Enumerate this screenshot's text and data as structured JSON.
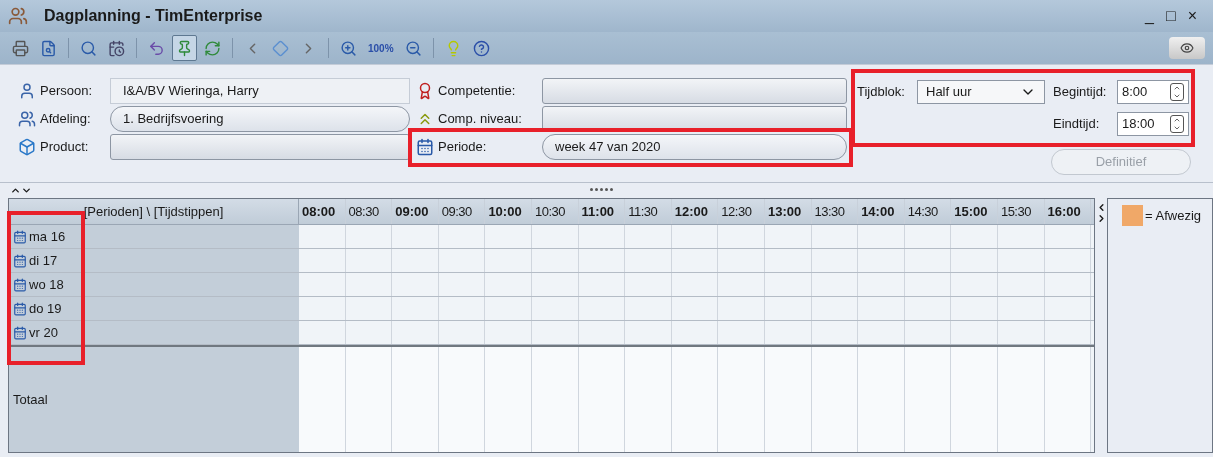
{
  "window": {
    "title": "Dagplanning - TimEnterprise",
    "controls": [
      "_",
      "□",
      "×"
    ]
  },
  "toolbar": [
    {
      "kind": "print",
      "pressed": false
    },
    {
      "kind": "preview",
      "pressed": false
    },
    {
      "kind": "sep"
    },
    {
      "kind": "search",
      "pressed": false
    },
    {
      "kind": "clock",
      "pressed": false
    },
    {
      "kind": "sep"
    },
    {
      "kind": "undo",
      "pressed": false
    },
    {
      "kind": "pin",
      "pressed": true
    },
    {
      "kind": "refresh",
      "pressed": false
    },
    {
      "kind": "sep"
    },
    {
      "kind": "prev",
      "pressed": false
    },
    {
      "kind": "diamond",
      "pressed": false
    },
    {
      "kind": "next",
      "pressed": false
    },
    {
      "kind": "sep"
    },
    {
      "kind": "zoomin",
      "pressed": false
    },
    {
      "kind": "zoom100",
      "label": "100%",
      "pressed": false
    },
    {
      "kind": "zoomout",
      "pressed": false
    },
    {
      "kind": "sep"
    },
    {
      "kind": "bulb",
      "pressed": false
    },
    {
      "kind": "help",
      "pressed": false
    }
  ],
  "form": {
    "left": [
      {
        "label": "Persoon:",
        "kind": "flat",
        "value": "I&A/BV Wieringa, Harry"
      },
      {
        "label": "Afdeling:",
        "kind": "pill",
        "value": "1. Bedrijfsvoering"
      },
      {
        "label": "Product:",
        "kind": "lookup"
      }
    ],
    "middle": [
      {
        "label": "Competentie:",
        "kind": "lookup",
        "highlighted": false
      },
      {
        "label": "Comp. niveau:",
        "kind": "lookup",
        "highlighted": false
      },
      {
        "label": "Periode:",
        "kind": "pill",
        "value": "week 47 van 2020",
        "highlighted": true
      }
    ],
    "time": {
      "highlighted": true,
      "block_label": "Tijdblok:",
      "block_value": "Half uur",
      "start_label": "Begintijd:",
      "start_value": "8:00",
      "end_label": "Eindtijd:",
      "end_value": "18:00"
    },
    "button": {
      "label": "Definitief",
      "disabled": true
    }
  },
  "grid": {
    "corner": "[Perioden] \\ [Tijdstippen]",
    "rows_highlighted": true,
    "times": [
      {
        "label": "08:00",
        "hour": true
      },
      {
        "label": "08:30",
        "hour": false
      },
      {
        "label": "09:00",
        "hour": true
      },
      {
        "label": "09:30",
        "hour": false
      },
      {
        "label": "10:00",
        "hour": true
      },
      {
        "label": "10:30",
        "hour": false
      },
      {
        "label": "11:00",
        "hour": true
      },
      {
        "label": "11:30",
        "hour": false
      },
      {
        "label": "12:00",
        "hour": true
      },
      {
        "label": "12:30",
        "hour": false
      },
      {
        "label": "13:00",
        "hour": true
      },
      {
        "label": "13:30",
        "hour": false
      },
      {
        "label": "14:00",
        "hour": true
      },
      {
        "label": "14:30",
        "hour": false
      },
      {
        "label": "15:00",
        "hour": true
      },
      {
        "label": "15:30",
        "hour": false
      },
      {
        "label": "16:00",
        "hour": true
      }
    ],
    "rows": [
      {
        "label": "ma 16"
      },
      {
        "label": "di 17"
      },
      {
        "label": "wo 18"
      },
      {
        "label": "do 19"
      },
      {
        "label": "vr 20"
      }
    ],
    "total_label": "Totaal"
  },
  "legend": [
    {
      "label": "= Afwezig",
      "color": "#f0a868"
    }
  ]
}
